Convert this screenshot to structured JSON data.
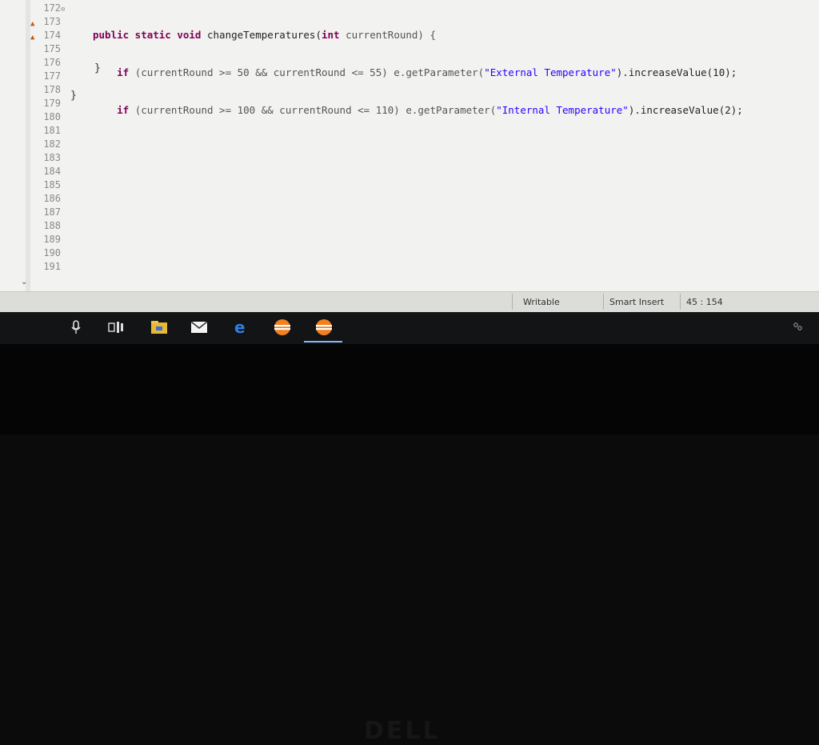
{
  "editor": {
    "line_numbers": [
      "172",
      "173",
      "174",
      "175",
      "176",
      "177",
      "178",
      "179",
      "180",
      "181",
      "182",
      "183",
      "184",
      "185",
      "186",
      "187",
      "188",
      "189",
      "190",
      "191"
    ],
    "code": {
      "l1": {
        "kw1": "public static void ",
        "fn": "changeTemperatures(",
        "kw2": "int ",
        "param": "currentRound) {"
      },
      "l2": {
        "indent": "    ",
        "kw": "if ",
        "cond": "(currentRound >= 50 && currentRound <= 55) e.getParameter(",
        "str": "\"External Temperature\"",
        "tail": ").increaseValue(10);"
      },
      "l3": {
        "indent": "    ",
        "kw": "if ",
        "cond": "(currentRound >= 100 && currentRound <= 110) e.getParameter(",
        "str": "\"Internal Temperature\"",
        "tail": ").increaseValue(2);"
      },
      "close_inner": "}",
      "close_outer": "}"
    }
  },
  "statusbar": {
    "writable": "Writable",
    "insert_mode": "Smart Insert",
    "position": "45 : 154"
  },
  "taskbar": {
    "icons": [
      "microphone-icon",
      "task-view-icon",
      "file-explorer-icon",
      "mail-icon",
      "edge-icon",
      "eclipse-icon",
      "eclipse-active-icon"
    ]
  },
  "bezel": {
    "logo": "DELL"
  }
}
